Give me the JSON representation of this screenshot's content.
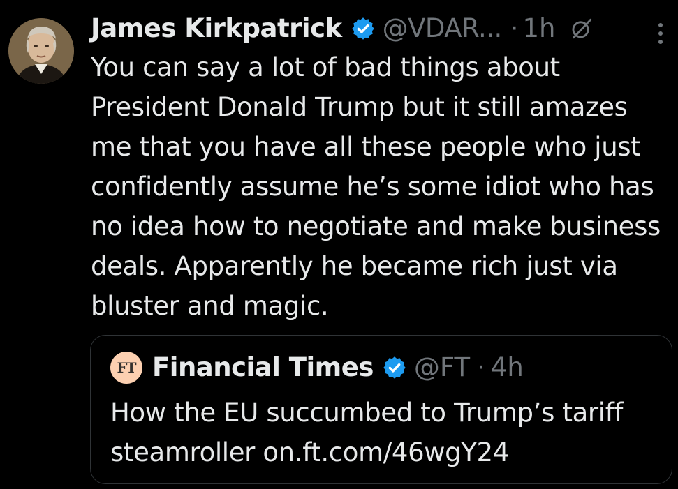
{
  "tweet": {
    "author": {
      "display_name": "James Kirkpatrick",
      "handle": "@VDAR...",
      "verified": true,
      "avatar_icon": "portrait-avatar"
    },
    "separator": "·",
    "timestamp": "1h",
    "text": "You can say a lot of bad things about President Donald Trump but it still amazes me that you have all these people who just confidently assume he’s some idiot who has no idea how to negotiate and make business deals. Apparently he became rich just via bluster and magic.",
    "icons": {
      "grok": "grok-icon",
      "more": "more-options-icon"
    }
  },
  "quoted_tweet": {
    "author": {
      "display_name": "Financial Times",
      "handle": "@FT",
      "verified": true,
      "avatar_text": "FT"
    },
    "separator": "·",
    "timestamp": "4h",
    "text": "How the EU succumbed to Trump’s tariff steamroller on.ft.com/46wgY24"
  },
  "colors": {
    "background": "#000000",
    "primary_text": "#e7e9ea",
    "secondary_text": "#71767b",
    "verified_blue": "#1d9bf0",
    "border": "#2f3336",
    "ft_pink": "#fcd0b1"
  }
}
